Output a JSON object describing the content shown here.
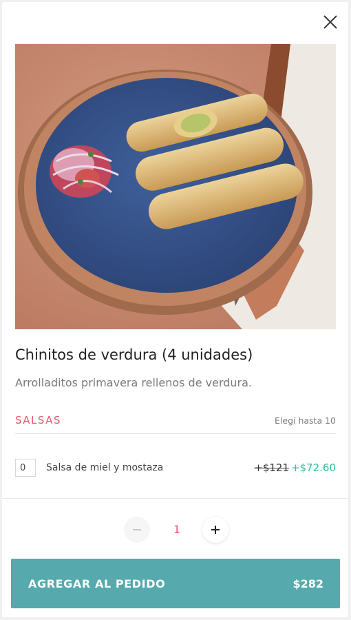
{
  "product": {
    "title": "Chinitos de verdura (4 unidades)",
    "description": "Arrolladitos primavera rellenos de verdura."
  },
  "options_group": {
    "title": "SALSAS",
    "limit_text": "Elegí hasta 10",
    "items": [
      {
        "quantity": "0",
        "label": "Salsa de miel y mostaza",
        "old_price": "+$121",
        "new_price": "+$72.60"
      }
    ]
  },
  "stepper": {
    "value": "1"
  },
  "add_button": {
    "label": "AGREGAR AL PEDIDO",
    "price": "$282"
  },
  "icons": {
    "close": "close-icon",
    "minus": "minus-icon",
    "plus": "plus-icon"
  },
  "colors": {
    "accent_red": "#e8566b",
    "price_green": "#2bbfa0",
    "button_teal": "#56a9ad"
  }
}
